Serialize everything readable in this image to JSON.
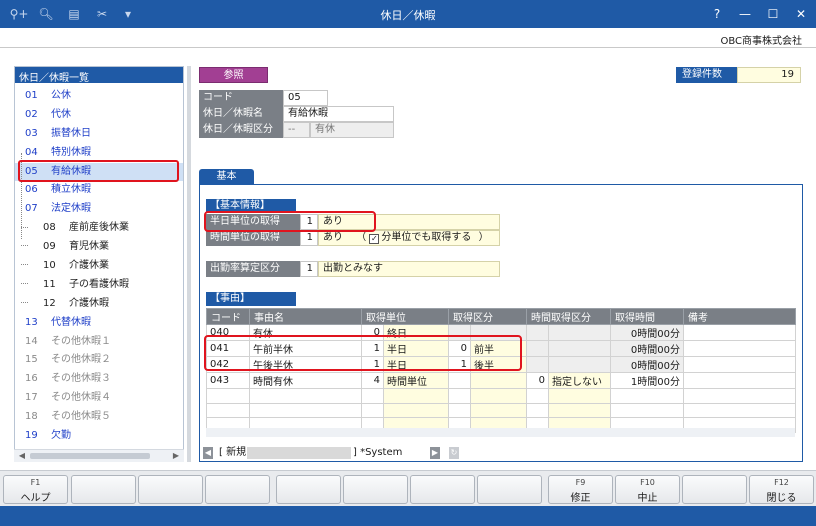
{
  "window": {
    "title": "休日／休暇"
  },
  "company": "OBC商事株式会社",
  "list": {
    "header": "休日／休暇一覧",
    "items": [
      {
        "code": "01",
        "name": "公休"
      },
      {
        "code": "02",
        "name": "代休"
      },
      {
        "code": "03",
        "name": "振替休日"
      },
      {
        "code": "04",
        "name": "特別休暇"
      },
      {
        "code": "05",
        "name": "有給休暇"
      },
      {
        "code": "06",
        "name": "積立休暇"
      },
      {
        "code": "07",
        "name": "法定休暇"
      },
      {
        "code": "08",
        "name": "産前産後休業"
      },
      {
        "code": "09",
        "name": "育児休業"
      },
      {
        "code": "10",
        "name": "介護休業"
      },
      {
        "code": "11",
        "name": "子の看護休暇"
      },
      {
        "code": "12",
        "name": "介護休暇"
      },
      {
        "code": "13",
        "name": "代替休暇"
      },
      {
        "code": "14",
        "name": "その他休暇１"
      },
      {
        "code": "15",
        "name": "その他休暇２"
      },
      {
        "code": "16",
        "name": "その他休暇３"
      },
      {
        "code": "17",
        "name": "その他休暇４"
      },
      {
        "code": "18",
        "name": "その他休暇５"
      },
      {
        "code": "19",
        "name": "欠勤"
      }
    ]
  },
  "toolbar": {
    "sansho_label": "参照"
  },
  "record_count": {
    "label": "登録件数",
    "value": "19"
  },
  "form": {
    "code_label": "コード",
    "code_value": "05",
    "name_label": "休日／休暇名",
    "name_value": "有給休暇",
    "kubun_label": "休日／休暇区分",
    "kubun_code": "--",
    "kubun_value": "有休"
  },
  "tab_label": "基本",
  "basic": {
    "section": "【基本情報】",
    "half_label": "半日単位の取得",
    "half_code": "1",
    "half_value": "あり",
    "hour_label": "時間単位の取得",
    "hour_code": "1",
    "hour_value": "あり",
    "paren_open": "（",
    "paren_close": "）",
    "minute_check": "✓",
    "minute_label": "分単位でも取得する",
    "attend_label": "出勤率算定区分",
    "attend_code": "1",
    "attend_value": "出勤とみなす"
  },
  "reasons": {
    "section": "【事由】",
    "columns": [
      "コード",
      "事由名",
      "取得単位",
      "取得区分",
      "時間取得区分",
      "取得時間",
      "備考"
    ],
    "rows": [
      {
        "code": "040",
        "name": "有休",
        "unit_code": "0",
        "unit": "終日",
        "div_code": "",
        "div": "",
        "time_code": "",
        "time_div": "",
        "time": "0時間00分",
        "note": ""
      },
      {
        "code": "041",
        "name": "午前半休",
        "unit_code": "1",
        "unit": "半日",
        "div_code": "0",
        "div": "前半",
        "time_code": "",
        "time_div": "",
        "time": "0時間00分",
        "note": ""
      },
      {
        "code": "042",
        "name": "午後半休",
        "unit_code": "1",
        "unit": "半日",
        "div_code": "1",
        "div": "後半",
        "time_code": "",
        "time_div": "",
        "time": "0時間00分",
        "note": ""
      },
      {
        "code": "043",
        "name": "時間有休",
        "unit_code": "4",
        "unit": "時間単位",
        "div_code": "",
        "div": "",
        "time_code": "0",
        "time_div": "指定しない",
        "time": "1時間00分",
        "note": ""
      }
    ]
  },
  "status": {
    "new_label": "[ 新規",
    "system_label": "] *System"
  },
  "fkeys": [
    {
      "key": "F1",
      "label": "ヘルプ"
    },
    {
      "key": "",
      "label": ""
    },
    {
      "key": "",
      "label": ""
    },
    {
      "key": "",
      "label": ""
    },
    {
      "key": "",
      "label": ""
    },
    {
      "key": "",
      "label": ""
    },
    {
      "key": "",
      "label": ""
    },
    {
      "key": "",
      "label": ""
    },
    {
      "key": "F9",
      "label": "修正"
    },
    {
      "key": "F10",
      "label": "中止"
    },
    {
      "key": "",
      "label": ""
    },
    {
      "key": "F12",
      "label": "閉じる"
    }
  ]
}
